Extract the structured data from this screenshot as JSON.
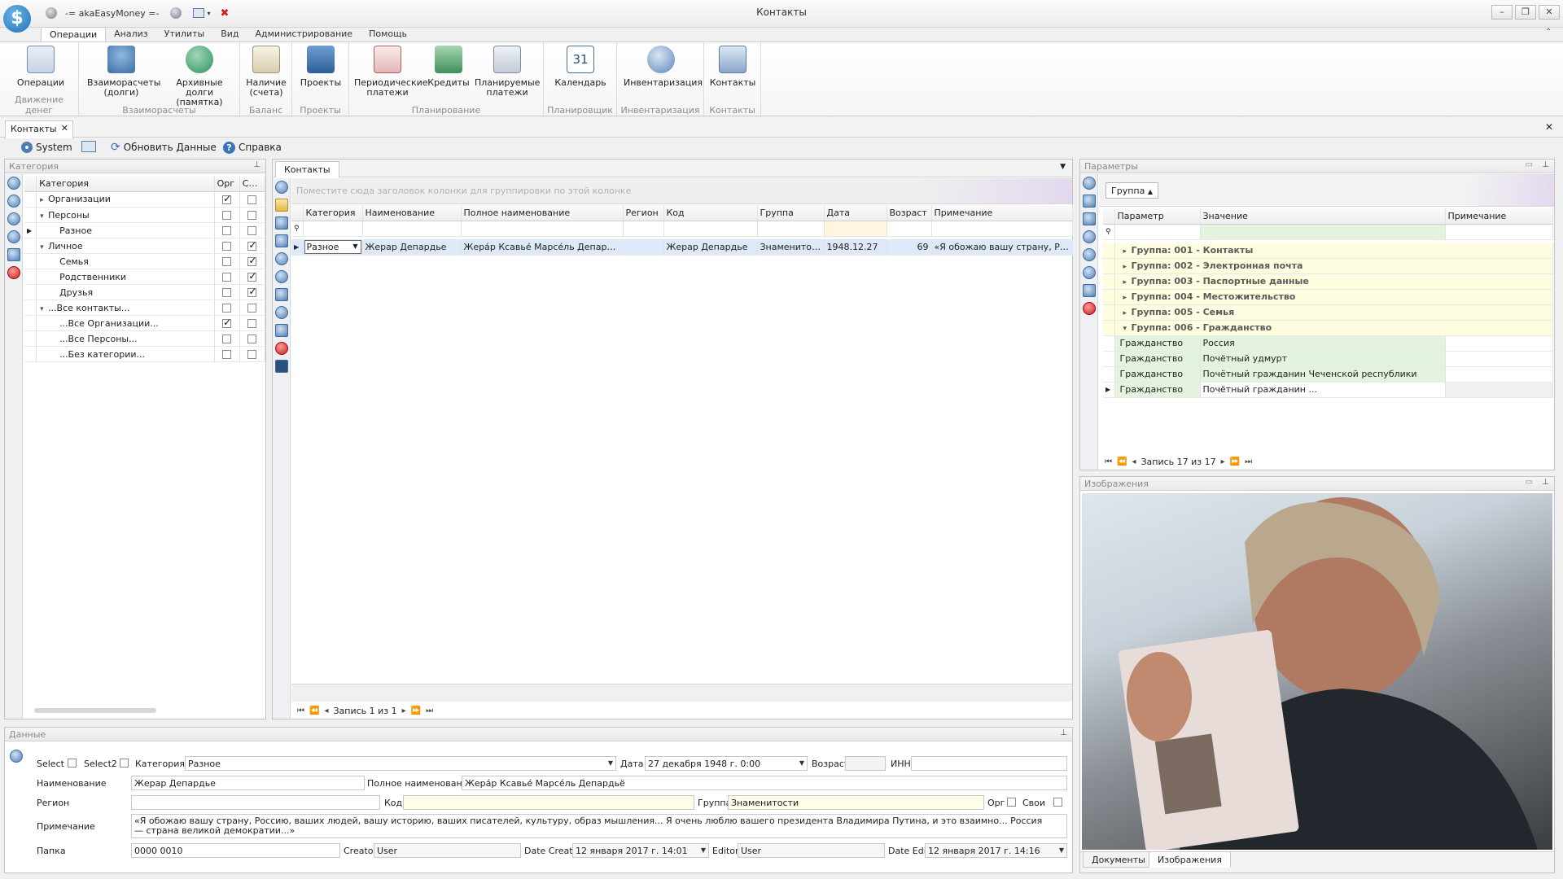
{
  "window": {
    "title": "Контакты",
    "qat_label": "-= akaEasyMoney =-",
    "app_icon_glyph": "$"
  },
  "menu_tabs": [
    "Операции",
    "Анализ",
    "Утилиты",
    "Вид",
    "Администрирование",
    "Помощь"
  ],
  "ribbon": {
    "groups": [
      {
        "label": "Движение денег",
        "buttons": [
          "Операции"
        ]
      },
      {
        "label": "Взаиморасчеты",
        "buttons": [
          "Взаиморасчеты (долги)",
          "Архивные долги (памятка)"
        ]
      },
      {
        "label": "Баланс",
        "buttons": [
          "Наличие (счета)"
        ]
      },
      {
        "label": "Проекты",
        "buttons": [
          "Проекты"
        ]
      },
      {
        "label": "Планирование",
        "buttons": [
          "Периодические платежи",
          "Кредиты",
          "Планируемые платежи"
        ]
      },
      {
        "label": "Планировщик",
        "buttons": [
          "Календарь"
        ]
      },
      {
        "label": "Инвентаризация",
        "buttons": [
          "Инвентаризация"
        ]
      },
      {
        "label": "Контакты",
        "buttons": [
          "Контакты"
        ]
      }
    ]
  },
  "doc_tab": "Контакты",
  "toolbar": {
    "system": "System",
    "refresh": "Обновить Данные",
    "help": "Справка"
  },
  "category_panel": {
    "title": "Категория",
    "columns": [
      "Категория",
      "Орг",
      "Свои"
    ],
    "rows": [
      {
        "label": "Организации",
        "level": 0,
        "exp": "▸",
        "org": true,
        "own": false
      },
      {
        "label": "Персоны",
        "level": 0,
        "exp": "▾",
        "org": false,
        "own": false
      },
      {
        "label": "Разное",
        "level": 1,
        "exp": "",
        "org": false,
        "own": false
      },
      {
        "label": "Личное",
        "level": 0,
        "exp": "▾",
        "org": false,
        "own": true
      },
      {
        "label": "Семья",
        "level": 1,
        "exp": "",
        "org": false,
        "own": true
      },
      {
        "label": "Родственники",
        "level": 1,
        "exp": "",
        "org": false,
        "own": true
      },
      {
        "label": "Друзья",
        "level": 1,
        "exp": "",
        "org": false,
        "own": true
      },
      {
        "label": "...Все контакты...",
        "level": 0,
        "exp": "▾",
        "org": false,
        "own": false
      },
      {
        "label": "...Все Организации...",
        "level": 1,
        "exp": "",
        "org": true,
        "own": false
      },
      {
        "label": "...Все Персоны...",
        "level": 1,
        "exp": "",
        "org": false,
        "own": false
      },
      {
        "label": "...Без категории...",
        "level": 1,
        "exp": "",
        "org": false,
        "own": false
      }
    ]
  },
  "contacts_panel": {
    "tab": "Контакты",
    "group_hint": "Поместите сюда заголовок колонки для группировки по этой колонке",
    "columns": [
      "Категория",
      "Наименование",
      "Полное наименование",
      "Регион",
      "Код",
      "Группа",
      "Дата",
      "Возраст",
      "Примечание"
    ],
    "row": [
      "Разное",
      "Жерар Депардье",
      "Жера́р Ксавье́ Марсе́ль Депардьё",
      "",
      "Жерар Депардье",
      "Знаменитости",
      "1948.12.27",
      "69",
      "«Я обожаю вашу страну, Ро..."
    ],
    "nav": "Запись 1 из 1"
  },
  "params_panel": {
    "title": "Параметры",
    "group_button": "Группа",
    "columns": [
      "Параметр",
      "Значение",
      "Примечание"
    ],
    "groups": [
      {
        "label": "Группа: 001 - Контакты",
        "exp": "▸"
      },
      {
        "label": "Группа: 002 - Электронная почта",
        "exp": "▸"
      },
      {
        "label": "Группа: 003 - Паспортные данные",
        "exp": "▸"
      },
      {
        "label": "Группа: 004 - Местожительство",
        "exp": "▸"
      },
      {
        "label": "Группа: 005 - Семья",
        "exp": "▸"
      },
      {
        "label": "Группа: 006 - Гражданство",
        "exp": "▾"
      }
    ],
    "rows": [
      {
        "param": "Гражданство",
        "value": "Россия"
      },
      {
        "param": "Гражданство",
        "value": "Почётный удмурт"
      },
      {
        "param": "Гражданство",
        "value": "Почётный гражданин Чеченской республики"
      },
      {
        "param": "Гражданство",
        "value": "Почётный гражданин ..."
      }
    ],
    "nav": "Запись 17 из 17"
  },
  "images_panel": {
    "title": "Изображения"
  },
  "data_panel": {
    "title": "Данные",
    "select": "Select",
    "select2": "Select2",
    "category_label": "Категория",
    "category_value": "Разное",
    "date_label": "Дата",
    "date_value": "27 декабря 1948 г. 0:00",
    "age_label": "Возраст",
    "age_value": "",
    "inn_label": "ИНН",
    "inn_value": "",
    "name_label": "Наименование",
    "name_value": "Жерар Депардье",
    "fullname_label": "Полное наименование",
    "fullname_value": "Жера́р Ксавье́ Марсе́ль Депардьё",
    "region_label": "Регион",
    "region_value": "",
    "code_label": "Код",
    "code_value": "",
    "group_label": "Группа",
    "group_value": "Знаменитости",
    "org_label": "Орг",
    "own_label": "Свои",
    "note_label": "Примечание",
    "note_value": "«Я обожаю вашу страну, Россию, ваших людей, вашу историю, ваших писателей, культуру, образ мышления... Я очень люблю вашего президента Владимира Путина, и это взаимно... Россия — страна великой демократии...»",
    "folder_label": "Папка",
    "folder_value": "0000 0010",
    "creator_label": "Creator",
    "creator_value": "User",
    "date_create_label": "Date Create",
    "date_create_value": "12 января 2017 г. 14:01",
    "editor_label": "Editor",
    "editor_value": "User",
    "date_edit_label": "Date Edit",
    "date_edit_value": "12 января 2017 г. 14:16"
  },
  "bottom_tabs": [
    "Документы",
    "Изображения"
  ],
  "colors": {
    "accent": "#4f7eb3",
    "group_row_bg": "#fffde0",
    "value_green": "#e3f3de"
  }
}
